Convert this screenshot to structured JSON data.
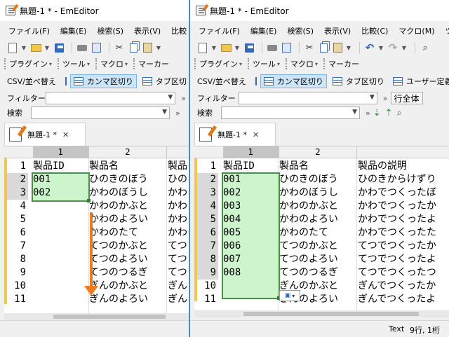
{
  "left": {
    "title": "無題-1 * - EmEditor",
    "menu": [
      "ファイル(F)",
      "編集(E)",
      "検索(S)",
      "表示(V)",
      "比較"
    ],
    "tools": [
      "プラグイン",
      "ツール",
      "マクロ",
      "マーカー"
    ],
    "csv": {
      "sort": "CSV/並べ替え",
      "comma": "カンマ区切り",
      "tab": "タブ区切"
    },
    "filter_label": "フィルター",
    "search_label": "検索",
    "tab_label": "無題-1 *",
    "columns": [
      "1",
      "2"
    ],
    "line_numbers": [
      "1",
      "2",
      "3",
      "4",
      "5",
      "6",
      "7",
      "8",
      "9",
      "10",
      "11"
    ],
    "col1": [
      "製品ID",
      "001",
      "002"
    ],
    "col2": [
      "製品名",
      "ひのきのぼう",
      "かわのぼうし",
      "かわのかぶと",
      "かわのよろい",
      "かわのたて",
      "てつのかぶと",
      "てつのよろい",
      "てつのつるぎ",
      "ぎんのかぶと",
      "ぎんのよろい"
    ],
    "col3": [
      "製品",
      "ひの",
      "かわ",
      "かわ",
      "かわ",
      "かわ",
      "てつ",
      "てつ",
      "てつ",
      "ぎん",
      "ぎん"
    ]
  },
  "right": {
    "title": "無題-1 * - EmEditor",
    "menu": [
      "ファイル(F)",
      "編集(E)",
      "検索(S)",
      "表示(V)",
      "比較(C)",
      "マクロ(M)",
      "ツ"
    ],
    "tools": [
      "プラグイン",
      "ツール",
      "マクロ",
      "マーカー"
    ],
    "csv": {
      "sort": "CSV/並べ替え",
      "comma": "カンマ区切り",
      "tab": "タブ区切り",
      "user": "ユーザー定義"
    },
    "filter_label": "フィルター",
    "scope": "行全体",
    "search_label": "検索",
    "tab_label": "無題-1 *",
    "columns": [
      "1",
      "2"
    ],
    "line_numbers": [
      "1",
      "2",
      "3",
      "4",
      "5",
      "6",
      "7",
      "8",
      "9",
      "10",
      "11"
    ],
    "col1": [
      "製品ID",
      "001",
      "002",
      "003",
      "004",
      "005",
      "006",
      "007",
      "008"
    ],
    "col2": [
      "製品名",
      "ひのきのぼう",
      "かわのぼうし",
      "かわのかぶと",
      "かわのよろい",
      "かわのたて",
      "てつのかぶと",
      "てつのよろい",
      "てつのつるぎ",
      "ぎんのかぶと",
      "ぎんのよろい"
    ],
    "col3": [
      "製品の説明",
      "ひのきからけずり",
      "かわでつくったぼ",
      "かわでつくったか",
      "かわでつくったよ",
      "かわでつくったた",
      "てつでつくったか",
      "てつでつくったよ",
      "てつでつくったつ",
      "ぎんでつくったか",
      "ぎんでつくったよ"
    ],
    "status": {
      "mode": "Text",
      "selection": "9行, 1桁"
    }
  },
  "colors": {
    "selection_fill": "#ccf5cc",
    "selection_border": "#4b8f4b",
    "arrow": "#f07b1e",
    "active_button": "#cce4f7"
  }
}
